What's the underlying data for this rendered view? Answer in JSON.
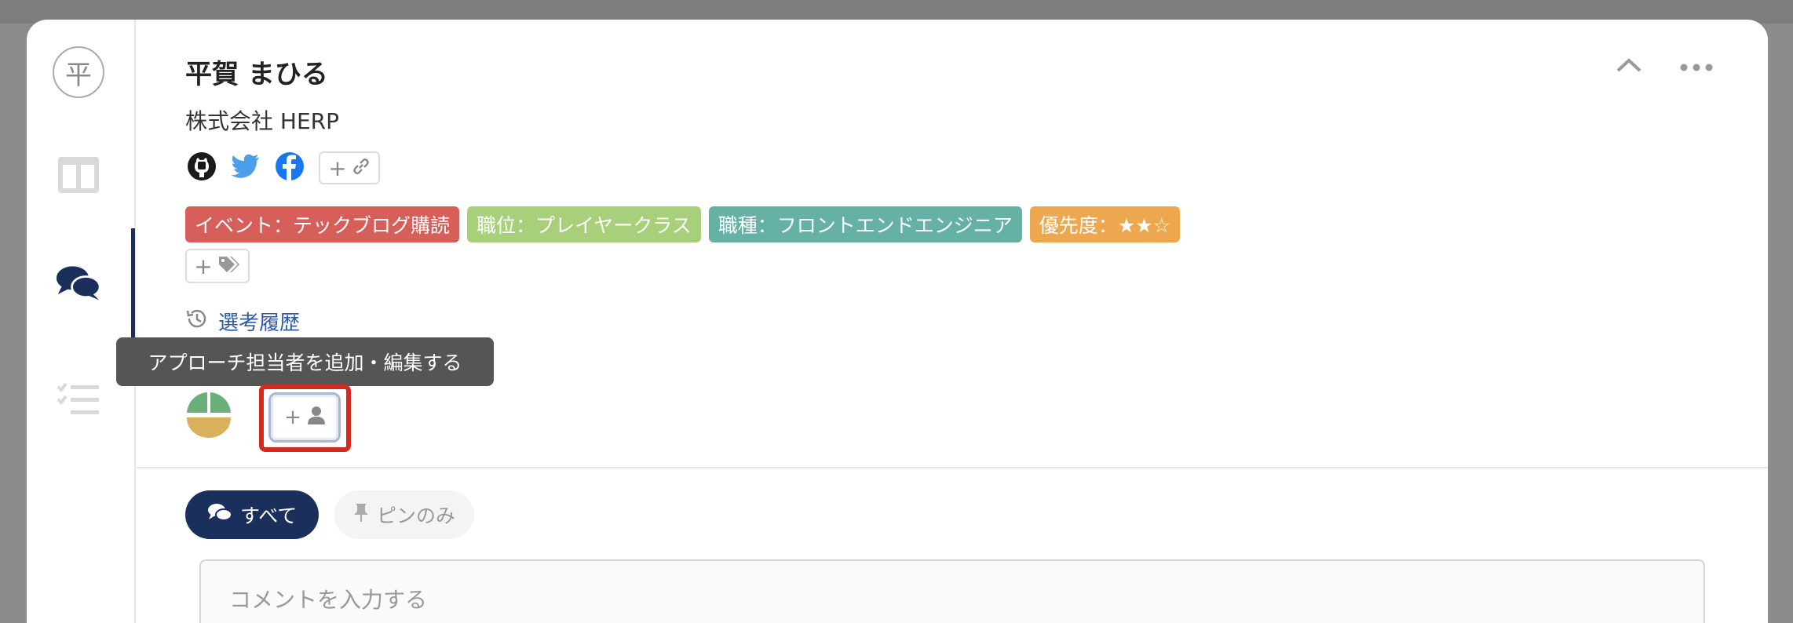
{
  "candidate": {
    "name": "平賀 まひる",
    "company": "株式会社 HERP",
    "avatar_initial": "平"
  },
  "social_links": [
    "github-icon",
    "twitter-icon",
    "facebook-icon"
  ],
  "add_link_label": "+",
  "tags": [
    {
      "label": "イベント：テックブログ購読",
      "color": "#d65f5a"
    },
    {
      "label": "職位：プレイヤークラス",
      "color": "#a8cf79"
    },
    {
      "label": "職種：フロントエンドエンジニア",
      "color": "#66b1a5"
    },
    {
      "label": "優先度：★★☆",
      "color": "#eda74e"
    }
  ],
  "add_tag_label": "+",
  "history_link": "選考履歴",
  "tooltip": "アプローチ担当者を追加・編集する",
  "add_assignee_label": "+",
  "filters": {
    "all": "すべて",
    "pinned": "ピンのみ"
  },
  "comment_placeholder": "コメントを入力する",
  "colors": {
    "navy": "#1b2f5c",
    "highlight": "#d42a1f",
    "link": "#2e5aa6"
  }
}
